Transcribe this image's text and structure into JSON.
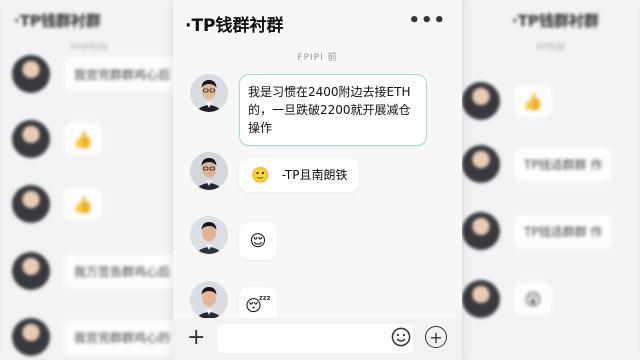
{
  "left_panel": {
    "title": "·TP钱群衬群",
    "time": "FPIP时间",
    "messages": [
      {
        "type": "text",
        "text": "我官完群群鸡心后"
      },
      {
        "type": "emoji",
        "emoji": "👍"
      },
      {
        "type": "emoji",
        "emoji": "👍"
      },
      {
        "type": "text",
        "text": "我万签告群鸡心后"
      },
      {
        "type": "text",
        "text": "我官完群群鸡心的"
      }
    ]
  },
  "right_panel": {
    "title": "·TP钱群衬群",
    "time": "PP时前",
    "messages": [
      {
        "type": "emoji",
        "emoji": "👍"
      },
      {
        "type": "text",
        "text": "TP钱适群群 作"
      },
      {
        "type": "text",
        "text": "TP钱适群群 作"
      },
      {
        "type": "emoji",
        "emoji": "😮"
      }
    ]
  },
  "chat": {
    "title": "·TP钱群衬群",
    "more_icon": "•••",
    "timestamp": "FPIPI 前",
    "messages": [
      {
        "kind": "text",
        "text": "我是习惯在2400附边去接ETH的，一旦跌破2200就开展减仓操作"
      },
      {
        "kind": "text-emoji",
        "emoji": "🙂",
        "text": "-TP且南朗铁"
      },
      {
        "kind": "emoji",
        "emoji": "😌"
      },
      {
        "kind": "emoji",
        "emoji": "😴"
      }
    ]
  },
  "input_bar": {
    "left_icon": "+",
    "emoji_icon": "smiley-icon",
    "right_icon": "+"
  }
}
